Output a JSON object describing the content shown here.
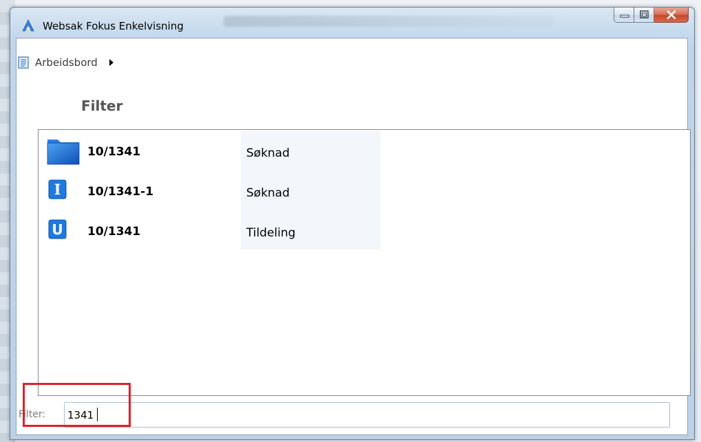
{
  "window": {
    "title": "Websak Fokus Enkelvisning",
    "controls": {
      "minimize_icon": "minimize-icon",
      "maximize_icon": "maximize-icon",
      "close_icon": "close-icon"
    }
  },
  "breadcrumb": {
    "label": "Arbeidsbord",
    "icon": "document-icon"
  },
  "heading": "Filter",
  "results": [
    {
      "icon": "folder-icon",
      "reference": "10/1341",
      "type": "Søknad"
    },
    {
      "icon": "incoming-document-icon",
      "icon_letter": "I",
      "reference": "10/1341-1",
      "type": "Søknad"
    },
    {
      "icon": "outgoing-document-icon",
      "icon_letter": "U",
      "reference": "10/1341",
      "type": "Tildeling"
    }
  ],
  "filter": {
    "label": "Filter:",
    "value": "1341"
  },
  "colors": {
    "highlight": "#e21e26",
    "icon_blue": "#1a6fd6",
    "type_column_bg": "#f3f6fb"
  }
}
